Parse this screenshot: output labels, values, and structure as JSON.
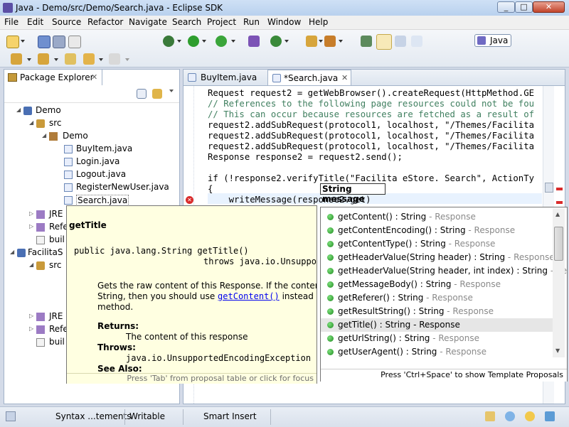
{
  "window": {
    "title": "Java - Demo/src/Demo/Search.java - Eclipse SDK",
    "minimize": "_",
    "maximize": "□",
    "close": "✕"
  },
  "menu": [
    "File",
    "Edit",
    "Source",
    "Refactor",
    "Navigate",
    "Search",
    "Project",
    "Run",
    "Window",
    "Help"
  ],
  "perspective": {
    "label": "Java"
  },
  "package_explorer": {
    "title": "Package Explorer",
    "tree": [
      {
        "label": "Demo",
        "icon": "project-icon"
      },
      {
        "label": "src",
        "icon": "source-folder-icon"
      },
      {
        "label": "Demo",
        "icon": "package-icon"
      },
      {
        "label": "BuyItem.java",
        "icon": "java-file-icon"
      },
      {
        "label": "Login.java",
        "icon": "java-file-icon"
      },
      {
        "label": "Logout.java",
        "icon": "java-file-icon"
      },
      {
        "label": "RegisterNewUser.java",
        "icon": "java-file-icon"
      },
      {
        "label": "Search.java",
        "icon": "java-file-icon"
      },
      {
        "label": "JRE S",
        "icon": "library-icon"
      },
      {
        "label": "Refe",
        "icon": "library-icon"
      },
      {
        "label": "buil",
        "icon": "file-icon"
      },
      {
        "label": "FacilitaS",
        "icon": "project-icon"
      },
      {
        "label": "src",
        "icon": "source-folder-icon"
      },
      {
        "label": "JRE S",
        "icon": "library-icon"
      },
      {
        "label": "Refe",
        "icon": "library-icon"
      },
      {
        "label": "buil",
        "icon": "file-icon"
      }
    ]
  },
  "editor": {
    "tabs": [
      {
        "label": "BuyItem.java"
      },
      {
        "label": "*Search.java"
      }
    ],
    "code": [
      "Request request2 = getWebBrowser().createRequest(HttpMethod.GE",
      "// References to the following page resources could not be fou",
      "// This can occur because resources are fetched as a result of",
      "request2.addSubRequest(protocol1, localhost, \"/Themes/Facilita",
      "request2.addSubRequest(protocol1, localhost, \"/Themes/Facilita",
      "request2.addSubRequest(protocol1, localhost, \"/Themes/Facilita",
      "Response response2 = request2.send();",
      "",
      "if (!response2.verifyTitle(\"Facilita eStore. Search\", ActionTy",
      "{",
      "    writeMessage(response2.get)"
    ]
  },
  "hover_hint": "String message",
  "javadoc": {
    "method": "getTitle",
    "signature_1": "public java.lang.String getTitle()",
    "signature_2": "throws java.io.Unsuppor",
    "desc_1": "Gets the raw content of this Response. If the content is a",
    "desc_2a": "String, then you should use ",
    "desc_link": "getContent()",
    "desc_2b": " instead of this",
    "desc_3": "method.",
    "returns_label": "Returns:",
    "returns_value": "The content of this response",
    "throws_label": "Throws:",
    "throws_value": "java.io.UnsupportedEncodingException",
    "see_also": "See Also:",
    "footer": "Press 'Tab' from proposal table or click for focus"
  },
  "proposals": {
    "items": [
      {
        "sig": "getContent() : String",
        "owner": " - Response"
      },
      {
        "sig": "getContentEncoding() : String",
        "owner": " - Response"
      },
      {
        "sig": "getContentType() : String",
        "owner": " - Response"
      },
      {
        "sig": "getHeaderValue(String header) : String",
        "owner": " - Response"
      },
      {
        "sig": "getHeaderValue(String header, int index) : String",
        "owner": " - Respon"
      },
      {
        "sig": "getMessageBody() : String",
        "owner": " - Response"
      },
      {
        "sig": "getReferer() : String",
        "owner": " - Response"
      },
      {
        "sig": "getResultString() : String",
        "owner": " - Response"
      },
      {
        "sig": "getTitle() : String",
        "owner": " - Response"
      },
      {
        "sig": "getUrlString() : String",
        "owner": " - Response"
      },
      {
        "sig": "getUserAgent() : String",
        "owner": " - Response"
      }
    ],
    "selected": 8,
    "footer": "Press 'Ctrl+Space' to show Template Proposals"
  },
  "statusbar": {
    "mode": "Syntax ...tements",
    "writable": "Writable",
    "insert": "Smart Insert"
  }
}
